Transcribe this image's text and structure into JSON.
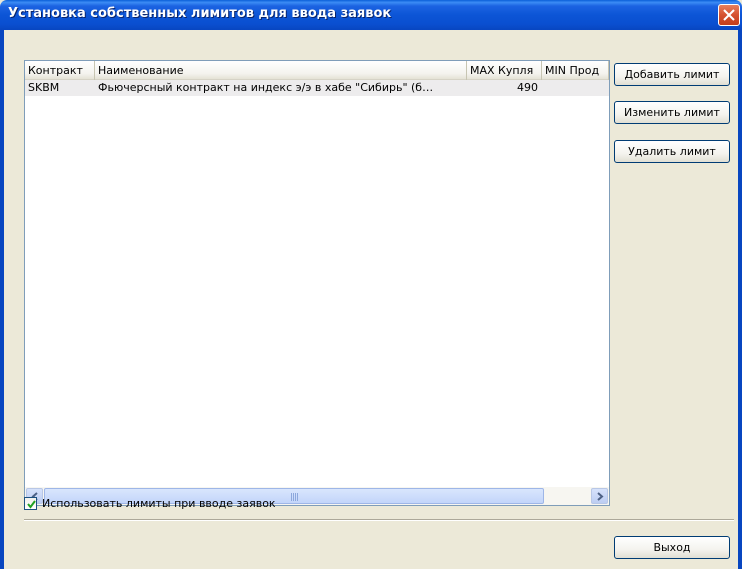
{
  "window": {
    "title": "Установка собственных лимитов для ввода заявок"
  },
  "list": {
    "columns": [
      "Контракт",
      "Наименование",
      "MAX Купля",
      "MIN Прод"
    ],
    "rows": [
      {
        "contract": "SKBM",
        "name": "Фьючерсный контракт на индекс э/э в хабе \"Сибирь\" (б…",
        "max_buy": "490",
        "min_sell": ""
      }
    ]
  },
  "scrollbar": {
    "position_fraction": 0.0
  },
  "buttons": {
    "add": "Добавить лимит",
    "edit": "Изменить лимит",
    "delete": "Удалить лимит",
    "exit": "Выход"
  },
  "options": {
    "use_limits_label": "Использовать лимиты при вводе заявок",
    "use_limits_checked": true
  },
  "colors": {
    "titlebar": "#0a4fd0",
    "close_button": "#d5512f",
    "selected_row": "#edeced"
  }
}
